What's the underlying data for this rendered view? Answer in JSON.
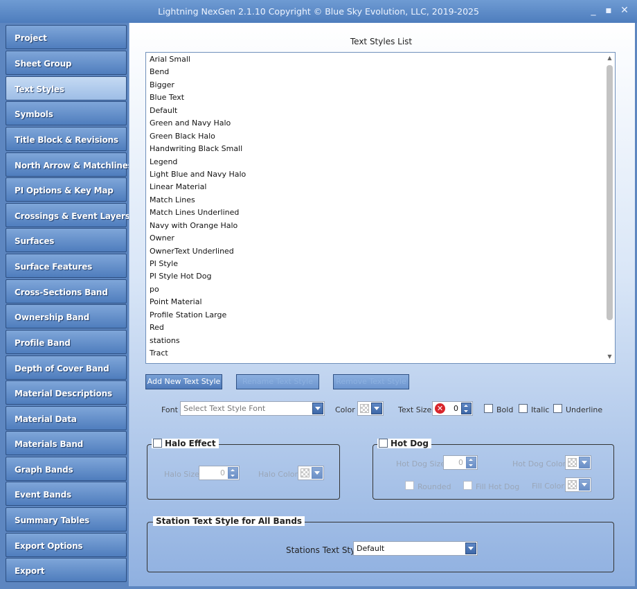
{
  "window": {
    "title": "Lightning NexGen 2.1.10 Copyright © Blue Sky Evolution, LLC, 2019-2025",
    "minimize": "_",
    "maximize": "▪",
    "close": "✕"
  },
  "sidebar": {
    "items": [
      {
        "label": "Project"
      },
      {
        "label": "Sheet Group"
      },
      {
        "label": "Text Styles",
        "active": true
      },
      {
        "label": "Symbols"
      },
      {
        "label": "Title Block & Revisions"
      },
      {
        "label": "North Arrow & Matchlines"
      },
      {
        "label": "PI Options & Key Map"
      },
      {
        "label": "Crossings & Event Layers"
      },
      {
        "label": "Surfaces"
      },
      {
        "label": "Surface Features"
      },
      {
        "label": "Cross-Sections Band"
      },
      {
        "label": "Ownership Band"
      },
      {
        "label": "Profile Band"
      },
      {
        "label": "Depth of Cover Band"
      },
      {
        "label": "Material Descriptions"
      },
      {
        "label": "Material Data"
      },
      {
        "label": "Materials Band"
      },
      {
        "label": "Graph Bands"
      },
      {
        "label": "Event Bands"
      },
      {
        "label": "Summary Tables"
      },
      {
        "label": "Export Options"
      },
      {
        "label": "Export"
      }
    ]
  },
  "main": {
    "list_title": "Text Styles List",
    "text_styles": [
      "Arial Small",
      "Bend",
      "Bigger",
      "Blue Text",
      "Default",
      "Green and Navy Halo",
      "Green Black Halo",
      "Handwriting Black Small",
      "Legend",
      "Light Blue and Navy Halo",
      "Linear Material",
      "Match Lines",
      "Match Lines Underlined",
      "Navy with Orange Halo",
      "Owner",
      "OwnerText Underlined",
      "PI Style",
      "PI Style Hot Dog",
      "po",
      "Point Material",
      "Profile Station Large",
      "Red",
      "stations",
      "Tract"
    ],
    "buttons": {
      "add": "Add New Text Style",
      "rename": "Rename Text Style",
      "remove": "Remove Text Style"
    },
    "font": {
      "label": "Font",
      "placeholder": "Select Text Style Font"
    },
    "color_label": "Color",
    "text_size": {
      "label": "Text Size",
      "value": "0"
    },
    "bold_label": "Bold",
    "italic_label": "Italic",
    "underline_label": "Underline",
    "halo": {
      "legend": "Halo Effect",
      "size_label": "Halo Size",
      "size_value": "0",
      "color_label": "Halo Color"
    },
    "hotdog": {
      "legend": "Hot Dog",
      "size_label": "Hot Dog Size",
      "size_value": "0",
      "color_label": "Hot Dog Color",
      "rounded_label": "Rounded",
      "fill_label": "Fill Hot Dog",
      "fill_color_label": "Fill Color"
    },
    "station": {
      "legend": "Station Text Style for All Bands",
      "label": "Stations Text Style",
      "value": "Default"
    }
  }
}
